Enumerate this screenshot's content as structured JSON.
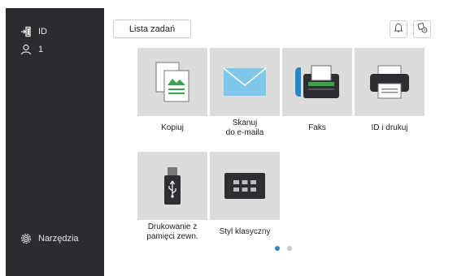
{
  "sidebar": {
    "id_label": "ID",
    "user_count": "1",
    "tools_label": "Narzędzia"
  },
  "header": {
    "job_list_label": "Lista zadań"
  },
  "tiles": [
    {
      "label": "Kopiuj",
      "icon": "copy-icon"
    },
    {
      "label": "Skanuj\ndo e-maila",
      "icon": "email-envelope-icon"
    },
    {
      "label": "Faks",
      "icon": "fax-icon"
    },
    {
      "label": "ID i drukuj",
      "icon": "printer-icon"
    },
    {
      "label": "Drukowanie z\npamięci zewn.",
      "icon": "usb-drive-icon"
    },
    {
      "label": "Styl klasyczny",
      "icon": "keypad-icon"
    }
  ],
  "pagination": {
    "active_index": 0,
    "count": 2
  },
  "colors": {
    "sidebar": "#2b2b30",
    "tile_bg": "#dcdcdc",
    "accent_blue": "#2a87c6",
    "envelope": "#7fc8ea"
  }
}
